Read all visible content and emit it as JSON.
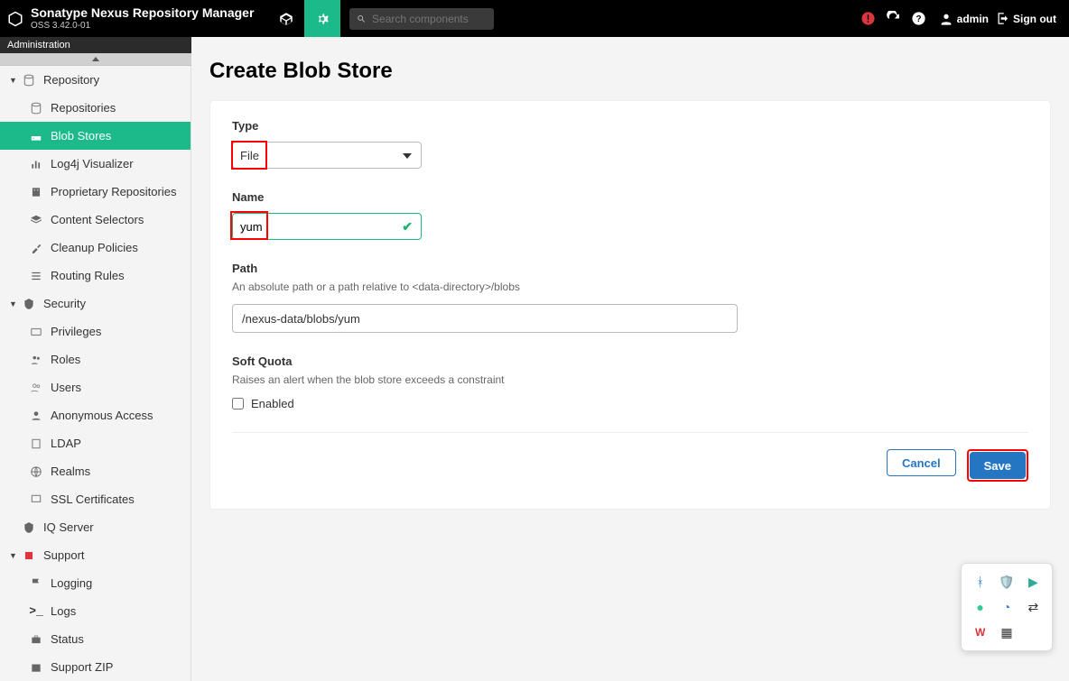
{
  "header": {
    "app_title": "Sonatype Nexus Repository Manager",
    "app_version": "OSS 3.42.0-01",
    "search_placeholder": "Search components",
    "user_label": "admin",
    "signout_label": "Sign out"
  },
  "subheader": {
    "label": "Administration"
  },
  "sidebar": {
    "repository": {
      "label": "Repository",
      "items": {
        "repositories": "Repositories",
        "blob_stores": "Blob Stores",
        "log4j": "Log4j Visualizer",
        "proprietary": "Proprietary Repositories",
        "content_selectors": "Content Selectors",
        "cleanup": "Cleanup Policies",
        "routing": "Routing Rules"
      }
    },
    "security": {
      "label": "Security",
      "items": {
        "privileges": "Privileges",
        "roles": "Roles",
        "users": "Users",
        "anonymous": "Anonymous Access",
        "ldap": "LDAP",
        "realms": "Realms",
        "ssl": "SSL Certificates"
      }
    },
    "iq_server": {
      "label": "IQ Server"
    },
    "support": {
      "label": "Support",
      "items": {
        "logging": "Logging",
        "logs": "Logs",
        "status": "Status",
        "support_zip": "Support ZIP"
      }
    }
  },
  "main": {
    "page_title": "Create Blob Store",
    "type": {
      "label": "Type",
      "value": "File"
    },
    "name": {
      "label": "Name",
      "value": "yum"
    },
    "path": {
      "label": "Path",
      "help": "An absolute path or a path relative to <data-directory>/blobs",
      "value": "/nexus-data/blobs/yum"
    },
    "soft_quota": {
      "label": "Soft Quota",
      "help": "Raises an alert when the blob store exceeds a constraint",
      "checkbox_label": "Enabled",
      "checked": false
    },
    "buttons": {
      "cancel": "Cancel",
      "save": "Save"
    }
  }
}
